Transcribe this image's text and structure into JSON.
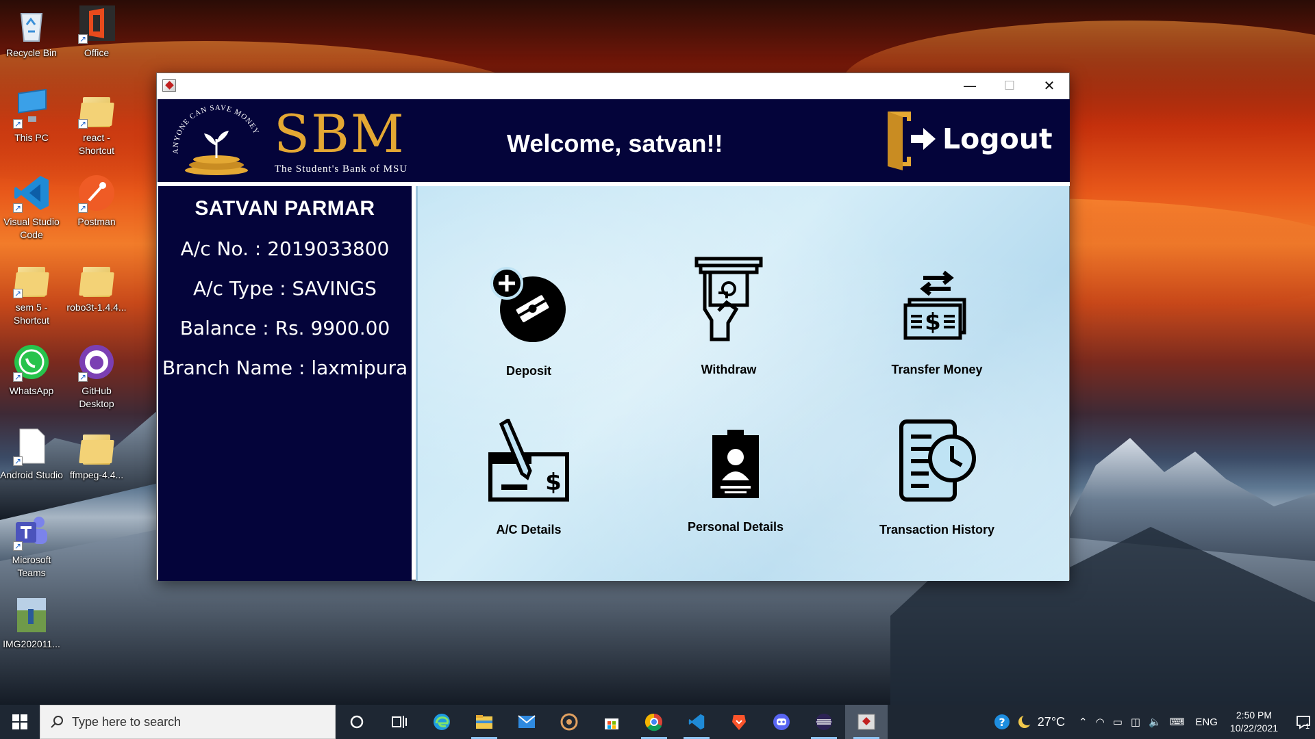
{
  "desktop": {
    "icons": [
      {
        "label": "Recycle Bin"
      },
      {
        "label": "Office"
      },
      {
        "label": "This PC"
      },
      {
        "label": "react - Shortcut"
      },
      {
        "label": "Visual Studio Code"
      },
      {
        "label": "Postman"
      },
      {
        "label": "sem 5 - Shortcut"
      },
      {
        "label": "robo3t-1.4.4..."
      },
      {
        "label": "WhatsApp"
      },
      {
        "label": "GitHub Desktop"
      },
      {
        "label": "Android Studio"
      },
      {
        "label": "ffmpeg-4.4..."
      },
      {
        "label": "Microsoft Teams"
      },
      {
        "label": "IMG202011..."
      }
    ]
  },
  "window": {
    "controls": {
      "minimize": "—",
      "maximize": "☐",
      "close": "✕"
    },
    "header": {
      "brand": "SBM",
      "tagline": "The Student's Bank of MSU",
      "motto": "ANYONE CAN SAVE MONEY",
      "welcome": "Welcome, satvan!!",
      "logout_label": "Logout"
    },
    "account": {
      "name": "SATVAN PARMAR",
      "account_number": "A/c No. : 2019033800",
      "account_type": "A/c Type : SAVINGS",
      "balance": "Balance : Rs. 9900.00",
      "branch": "Branch Name : laxmipura"
    },
    "actions": [
      {
        "label": "Deposit",
        "icon": "deposit-icon"
      },
      {
        "label": "Withdraw",
        "icon": "withdraw-icon"
      },
      {
        "label": "Transfer Money",
        "icon": "transfer-icon"
      },
      {
        "label": "A/C Details",
        "icon": "cheque-icon"
      },
      {
        "label": "Personal Details",
        "icon": "profile-card-icon"
      },
      {
        "label": "Transaction History",
        "icon": "history-icon"
      }
    ]
  },
  "taskbar": {
    "search_placeholder": "Type here to search",
    "weather": "27°C",
    "language": "ENG",
    "time": "2:50 PM",
    "date": "10/22/2021",
    "notification_count": "1"
  }
}
